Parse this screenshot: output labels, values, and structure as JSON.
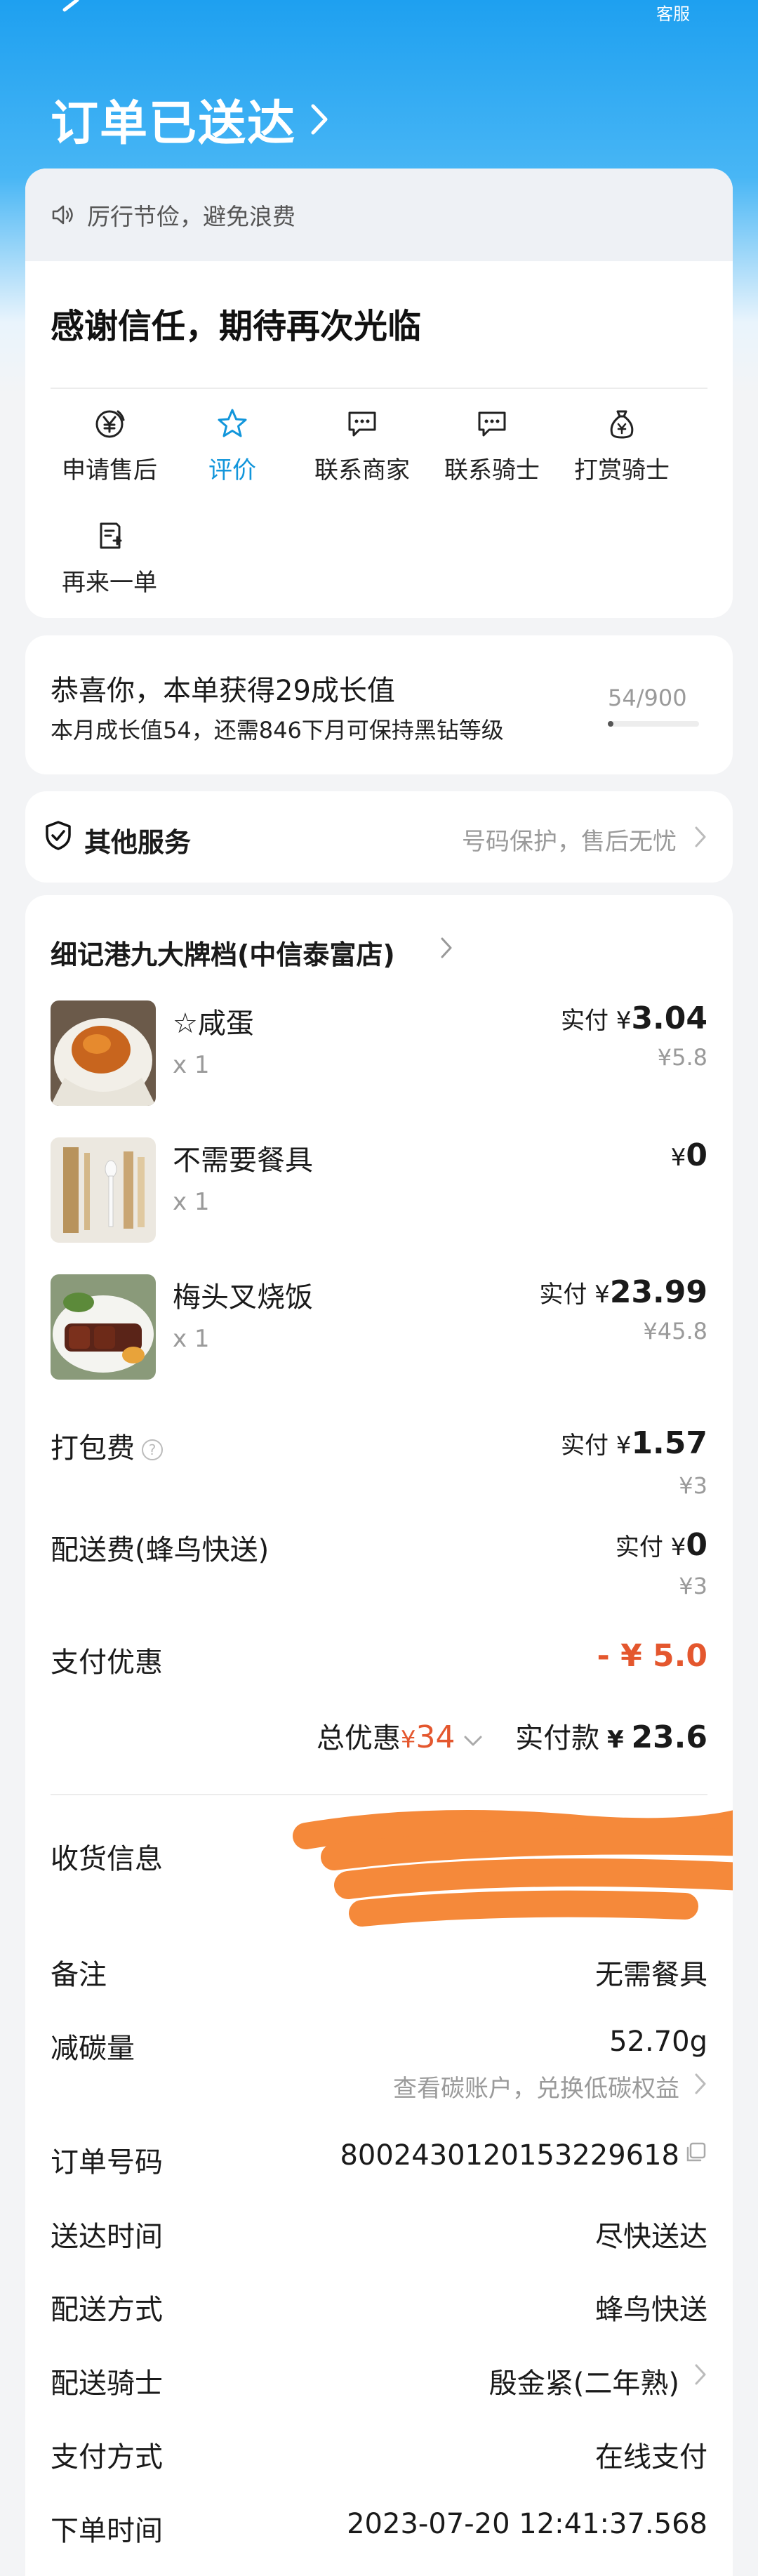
{
  "header": {
    "title": "订单已送达",
    "service_label": "客服"
  },
  "status_card": {
    "notice": "厉行节俭，避免浪费",
    "thanks": "感谢信任，期待再次光临",
    "actions": [
      {
        "label": "申请售后",
        "icon": "yuan-circle-icon"
      },
      {
        "label": "评价",
        "icon": "star-icon",
        "active": true
      },
      {
        "label": "联系商家",
        "icon": "chat-bubble-icon"
      },
      {
        "label": "联系骑士",
        "icon": "chat-bubble-icon"
      },
      {
        "label": "打赏骑士",
        "icon": "money-bag-icon"
      },
      {
        "label": "再来一单",
        "icon": "reorder-icon"
      }
    ]
  },
  "growth": {
    "main": "恭喜你，本单获得29成长值",
    "sub": "本月成长值54，还需846下月可保持黑钻等级",
    "count": "54/900",
    "progress": 0.06
  },
  "services": {
    "title": "其他服务",
    "right": "号码保护，售后无忧"
  },
  "order": {
    "shop": "细记港九大牌档(中信泰富店)",
    "items": [
      {
        "name": "☆咸蛋",
        "qty": "x 1",
        "paid_prefix": "实付",
        "currency": "¥",
        "amount": "3.04",
        "original": "¥5.8"
      },
      {
        "name": "不需要餐具",
        "qty": "x 1",
        "paid_prefix": "",
        "currency": "¥",
        "amount": "0",
        "original": ""
      },
      {
        "name": "梅头叉烧饭",
        "qty": "x 1",
        "paid_prefix": "实付",
        "currency": "¥",
        "amount": "23.99",
        "original": "¥45.8"
      }
    ],
    "packing": {
      "label": "打包费",
      "prefix": "实付",
      "currency": "¥",
      "amount": "1.57",
      "original": "¥3"
    },
    "delivery": {
      "label": "配送费(蜂鸟快送)",
      "prefix": "实付",
      "currency": "¥",
      "amount": "0",
      "original": "¥3"
    },
    "discount": {
      "label": "支付优惠",
      "value": "- ¥ 5.0"
    },
    "summary": {
      "total_discount_label": "总优惠",
      "total_discount_currency": "¥",
      "total_discount_value": "34",
      "paid_label": "实付款",
      "paid_currency": "¥",
      "paid_value": "23.6"
    },
    "info": [
      {
        "label": "收货信息",
        "value": ""
      },
      {
        "label": "备注",
        "value": "无需餐具"
      },
      {
        "label": "减碳量",
        "value": "52.70g"
      },
      {
        "label": "",
        "value": "查看碳账户，兑换低碳权益"
      },
      {
        "label": "订单号码",
        "value": "8002430120153229618"
      },
      {
        "label": "送达时间",
        "value": "尽快送达"
      },
      {
        "label": "配送方式",
        "value": "蜂鸟快送"
      },
      {
        "label": "配送骑士",
        "value": "殷金紧(二年熟)"
      },
      {
        "label": "支付方式",
        "value": "在线支付"
      },
      {
        "label": "下单时间",
        "value": "2023-07-20 12:41:37.568"
      }
    ]
  },
  "colors": {
    "header_blue": "#1ea0f0",
    "accent_blue": "#1296db",
    "price_red": "#e4572e",
    "redaction_orange": "#f5893a"
  }
}
